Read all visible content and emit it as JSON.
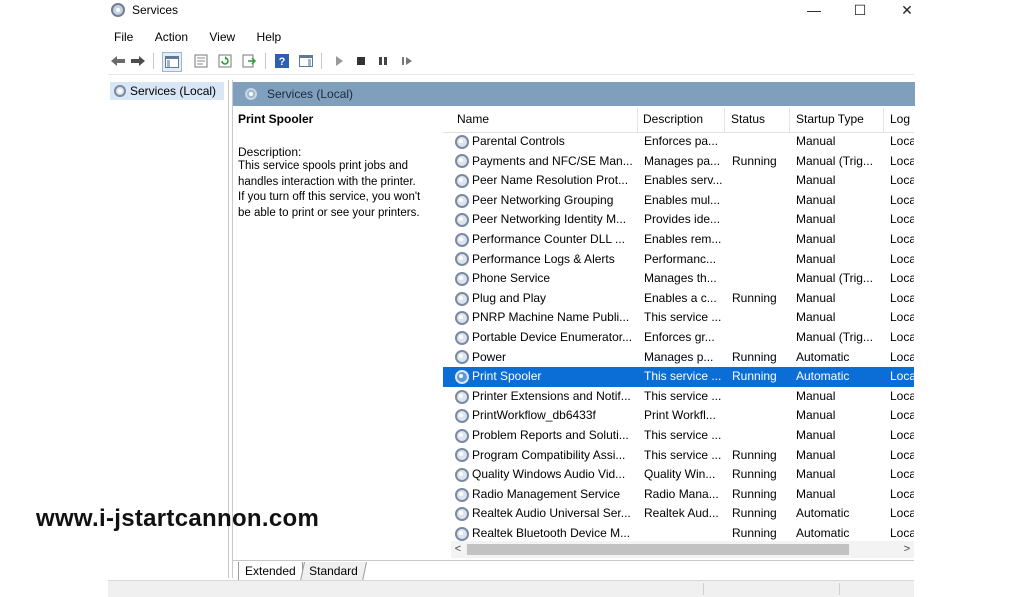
{
  "window": {
    "title": "Services",
    "controls": {
      "minimize": "—",
      "maximize": "☐",
      "close": "✕"
    }
  },
  "menu": [
    "File",
    "Action",
    "View",
    "Help"
  ],
  "toolbar": [
    "back-icon",
    "forward-icon",
    "show-hide-console-tree-icon",
    "properties-icon",
    "refresh-icon",
    "export-list-icon",
    "help-icon",
    "action-pane-icon",
    "start-service-icon",
    "stop-service-icon",
    "pause-service-icon",
    "resume-service-icon"
  ],
  "tree": {
    "item": "Services (Local)"
  },
  "pane": {
    "header": "Services (Local)"
  },
  "description": {
    "title": "Print Spooler",
    "label": "Description:",
    "lines": [
      "This service spools print jobs and",
      "handles interaction with the printer.",
      "If you turn off this service, you won't",
      "be able to print or see your printers."
    ]
  },
  "columns": {
    "name": "Name",
    "description": "Description",
    "status": "Status",
    "startup": "Startup Type",
    "log": "Log"
  },
  "rows": [
    {
      "name": "Parental Controls",
      "desc": "Enforces pa...",
      "status": "",
      "startup": "Manual",
      "log": "Loca"
    },
    {
      "name": "Payments and NFC/SE Man...",
      "desc": "Manages pa...",
      "status": "Running",
      "startup": "Manual (Trig...",
      "log": "Loca"
    },
    {
      "name": "Peer Name Resolution Prot...",
      "desc": "Enables serv...",
      "status": "",
      "startup": "Manual",
      "log": "Loca"
    },
    {
      "name": "Peer Networking Grouping",
      "desc": "Enables mul...",
      "status": "",
      "startup": "Manual",
      "log": "Loca"
    },
    {
      "name": "Peer Networking Identity M...",
      "desc": "Provides ide...",
      "status": "",
      "startup": "Manual",
      "log": "Loca"
    },
    {
      "name": "Performance Counter DLL ...",
      "desc": "Enables rem...",
      "status": "",
      "startup": "Manual",
      "log": "Loca"
    },
    {
      "name": "Performance Logs & Alerts",
      "desc": "Performanc...",
      "status": "",
      "startup": "Manual",
      "log": "Loca"
    },
    {
      "name": "Phone Service",
      "desc": "Manages th...",
      "status": "",
      "startup": "Manual (Trig...",
      "log": "Loca"
    },
    {
      "name": "Plug and Play",
      "desc": "Enables a c...",
      "status": "Running",
      "startup": "Manual",
      "log": "Loca"
    },
    {
      "name": "PNRP Machine Name Publi...",
      "desc": "This service ...",
      "status": "",
      "startup": "Manual",
      "log": "Loca"
    },
    {
      "name": "Portable Device Enumerator...",
      "desc": "Enforces gr...",
      "status": "",
      "startup": "Manual (Trig...",
      "log": "Loca"
    },
    {
      "name": "Power",
      "desc": "Manages p...",
      "status": "Running",
      "startup": "Automatic",
      "log": "Loca"
    },
    {
      "name": "Print Spooler",
      "desc": "This service ...",
      "status": "Running",
      "startup": "Automatic",
      "log": "Loca",
      "selected": true
    },
    {
      "name": "Printer Extensions and Notif...",
      "desc": "This service ...",
      "status": "",
      "startup": "Manual",
      "log": "Loca"
    },
    {
      "name": "PrintWorkflow_db6433f",
      "desc": "Print Workfl...",
      "status": "",
      "startup": "Manual",
      "log": "Loca"
    },
    {
      "name": "Problem Reports and Soluti...",
      "desc": "This service ...",
      "status": "",
      "startup": "Manual",
      "log": "Loca"
    },
    {
      "name": "Program Compatibility Assi...",
      "desc": "This service ...",
      "status": "Running",
      "startup": "Manual",
      "log": "Loca"
    },
    {
      "name": "Quality Windows Audio Vid...",
      "desc": "Quality Win...",
      "status": "Running",
      "startup": "Manual",
      "log": "Loca"
    },
    {
      "name": "Radio Management Service",
      "desc": "Radio Mana...",
      "status": "Running",
      "startup": "Manual",
      "log": "Loca"
    },
    {
      "name": "Realtek Audio Universal Ser...",
      "desc": "Realtek Aud...",
      "status": "Running",
      "startup": "Automatic",
      "log": "Loca"
    },
    {
      "name": "Realtek Bluetooth Device M...",
      "desc": "",
      "status": "Running",
      "startup": "Automatic",
      "log": "Loca"
    }
  ],
  "scroll": {
    "left": "<",
    "right": ">"
  },
  "tabs": {
    "extended": "Extended",
    "standard": "Standard"
  },
  "colors": {
    "selection": "#0a6ed6",
    "pane_header": "#7f9fbd",
    "tree_selected": "#d9e6f6"
  },
  "watermark": "www.i-jstartcannon.com"
}
